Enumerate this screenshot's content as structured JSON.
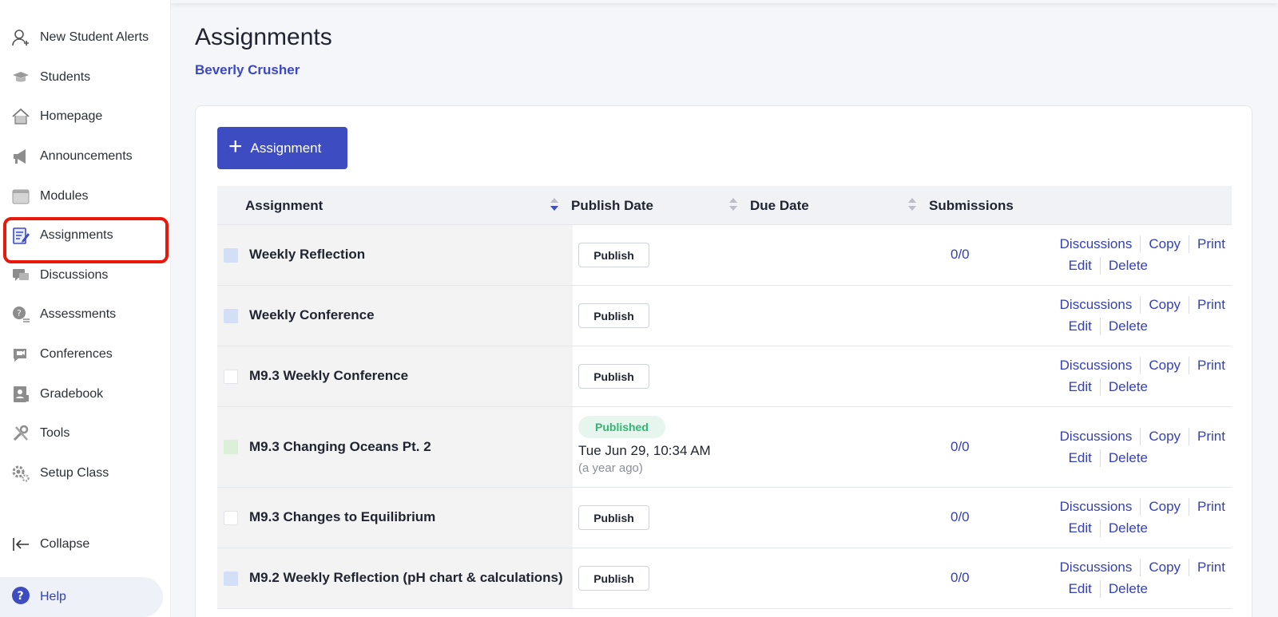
{
  "sidebar": {
    "items": [
      {
        "label": "New Student Alerts",
        "icon": "user-plus-icon"
      },
      {
        "label": "Students",
        "icon": "graduation-cap-icon"
      },
      {
        "label": "Homepage",
        "icon": "home-icon"
      },
      {
        "label": "Announcements",
        "icon": "megaphone-icon"
      },
      {
        "label": "Modules",
        "icon": "folder-icon"
      },
      {
        "label": "Assignments",
        "icon": "assignment-icon"
      },
      {
        "label": "Discussions",
        "icon": "chat-icon"
      },
      {
        "label": "Assessments",
        "icon": "assessment-icon"
      },
      {
        "label": "Conferences",
        "icon": "video-chat-icon"
      },
      {
        "label": "Gradebook",
        "icon": "gradebook-icon"
      },
      {
        "label": "Tools",
        "icon": "tools-icon"
      },
      {
        "label": "Setup Class",
        "icon": "gear-icon"
      }
    ],
    "active_item": "Assignments",
    "collapse_label": "Collapse",
    "help_label": "Help"
  },
  "header": {
    "title": "Assignments",
    "subtitle": "Beverly Crusher"
  },
  "toolbar": {
    "add_label": "Assignment"
  },
  "table": {
    "columns": [
      "Assignment",
      "Publish Date",
      "Due Date",
      "Submissions"
    ],
    "rows": [
      {
        "name": "Weekly Reflection",
        "publish": "Publish",
        "submissions": "0/0",
        "check_color": "#d3dff7"
      },
      {
        "name": "Weekly Conference",
        "publish": "Publish",
        "submissions": "",
        "check_color": "#d3dff7"
      },
      {
        "name": "M9.3 Weekly Conference",
        "publish": "Publish",
        "submissions": "",
        "check_color": "#ffffff"
      },
      {
        "name": "M9.3 Changing Oceans Pt. 2",
        "status": "Published",
        "date": "Tue Jun 29, 10:34 AM",
        "ago": "(a year ago)",
        "submissions": "0/0",
        "check_color": "#dcefd9"
      },
      {
        "name": "M9.3 Changes to Equilibrium",
        "publish": "Publish",
        "submissions": "0/0",
        "check_color": "#ffffff"
      },
      {
        "name": "M9.2 Weekly Reflection (pH chart & calculations)",
        "publish": "Publish",
        "submissions": "0/0",
        "check_color": "#d3dff7"
      }
    ],
    "actions": {
      "discussions": "Discussions",
      "copy": "Copy",
      "print": "Print",
      "edit": "Edit",
      "delete": "Delete"
    }
  },
  "colors": {
    "accent": "#3d4cc0",
    "link": "#3340b8",
    "published_green": "#2fb872",
    "highlight_red": "#e8190b"
  }
}
